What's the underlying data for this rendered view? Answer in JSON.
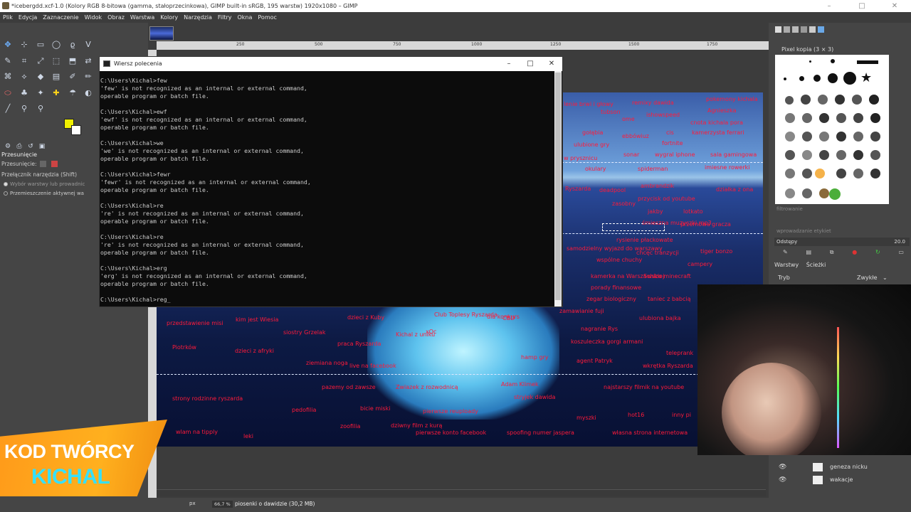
{
  "window": {
    "title": "*icebergdd.xcf-1.0 (Kolory RGB 8-bitowa (gamma, stałoprzecinkowa), GIMP built-in sRGB, 195 warstw) 1920x1080 – GIMP",
    "minimize": "–",
    "maximize": "□",
    "close": "✕"
  },
  "menu": [
    "Plik",
    "Edycja",
    "Zaznaczenie",
    "Widok",
    "Obraz",
    "Warstwa",
    "Kolory",
    "Narzędzia",
    "Filtry",
    "Okna",
    "Pomoc"
  ],
  "ruler": [
    "250",
    "500",
    "750",
    "1000",
    "1250",
    "1500",
    "1750"
  ],
  "tool_options": {
    "title": "Przesunięcie",
    "move_label": "Przesunięcie:",
    "switch_label": "Przełącznik narzędzia (Shift)",
    "radio1": "Wybór warstwy lub prowadnic",
    "radio2": "Przemieszczenie aktywnej wa"
  },
  "cmd": {
    "title": "Wiersz polecenia",
    "minimize": "–",
    "maximize": "□",
    "close": "✕",
    "lines": [
      "C:\\Users\\Kichal>few",
      "'few' is not recognized as an internal or external command,",
      "operable program or batch file.",
      "",
      "C:\\Users\\Kichal>ewf",
      "'ewf' is not recognized as an internal or external command,",
      "operable program or batch file.",
      "",
      "C:\\Users\\Kichal>we",
      "'we' is not recognized as an internal or external command,",
      "operable program or batch file.",
      "",
      "C:\\Users\\Kichal>fewr",
      "'fewr' is not recognized as an internal or external command,",
      "operable program or batch file.",
      "",
      "C:\\Users\\Kichal>re",
      "'re' is not recognized as an internal or external command,",
      "operable program or batch file.",
      "",
      "C:\\Users\\Kichal>re",
      "'re' is not recognized as an internal or external command,",
      "operable program or batch file.",
      "",
      "C:\\Users\\Kichal>erg",
      "'erg' is not recognized as an internal or external command,",
      "operable program or batch file.",
      "",
      "C:\\Users\\Kichal>reg_"
    ]
  },
  "iceberg_labels": [
    "lenie brwi i głowy",
    "remixy dawida",
    "pokemony kichala",
    "tubson",
    "ome",
    "ishowspeed",
    "Agnieszka",
    "gołąbia",
    "ebbówiuz",
    "cis",
    "cnota kichala pora",
    "kamerzysta ferrari",
    "fortnite",
    "ulubione gry",
    "sonar",
    "wygral iphone",
    "sala gamingowa",
    "w prysznicu",
    "okulary",
    "spiderman",
    "imiesne rowerki",
    "Ryszarda",
    "deadpool",
    "ambrandzik",
    "działka z ona",
    "przycisk od youtube",
    "zasobny",
    "jakby",
    "lotkato",
    "śmieszna muzyczki mp3",
    "przemowa gracza",
    "rysienie płackowate",
    "samodzielny wyjazd do warszawy",
    "chcęc tranzycji",
    "tiger bonzo",
    "wspólne chuchy",
    "campery",
    "kamerka na Warszawskiej",
    "Schizo minecraft",
    "porady finansowe",
    "zegar biologiczny",
    "taniec z babcią",
    "zamawianie fuji",
    "przedstawienie misi",
    "kim jest Wiesia",
    "dzieci z Kuby",
    "Club Toplesy Ryszarda",
    "dla konkurs",
    "CBD",
    "ulubiona bajka",
    "siostry Grzelak",
    "Kichal z uniku",
    "nagranie Rys",
    "Piotrków",
    "dzieci z afryki",
    "praca Ryszarda",
    "koszuleczka gorgi armani",
    "ziemiana noga",
    "live na facebook",
    "hamp gry",
    "agent Patryk",
    "teleprank",
    "wkrętka Ryszarda",
    "pazemy od zawsze",
    "Adam Klimek",
    "najstarszy filmik na youtube",
    "strony rodzinne ryszarda",
    "pedofilia",
    "bicie miski",
    "stryjek dawida",
    "myszki",
    "hot16",
    "inny pi",
    "wlam na tipply",
    "zoofilia",
    "dziwny film z kurą",
    "leki",
    "pierwsze konto facebook",
    "spoofing numer jaspera",
    "własna strona internetowa",
    "Zwiazek z rozwodnicą",
    "pierwsze reuploady",
    "xQc"
  ],
  "right_dock": {
    "brush_title": "Pixel kopia (3 × 3)",
    "filter": "filtrowanie",
    "tag": "wprowadzanie etykiet",
    "spacing_label": "Odstępy",
    "spacing_value": "20.0",
    "tab_layers": "Warstwy",
    "tab_paths": "Ścieżki",
    "mode_label": "Tryb",
    "mode_value": "Zwykłe",
    "layers": [
      "geneza nicku",
      "wakacje"
    ]
  },
  "status": {
    "unit": "px",
    "zoom": "66,7 %",
    "text": "piosenki o dawidzie (30,2 MB)"
  },
  "badge": {
    "line1": "KOD TWÓRCY",
    "line2": "KICHAL"
  }
}
